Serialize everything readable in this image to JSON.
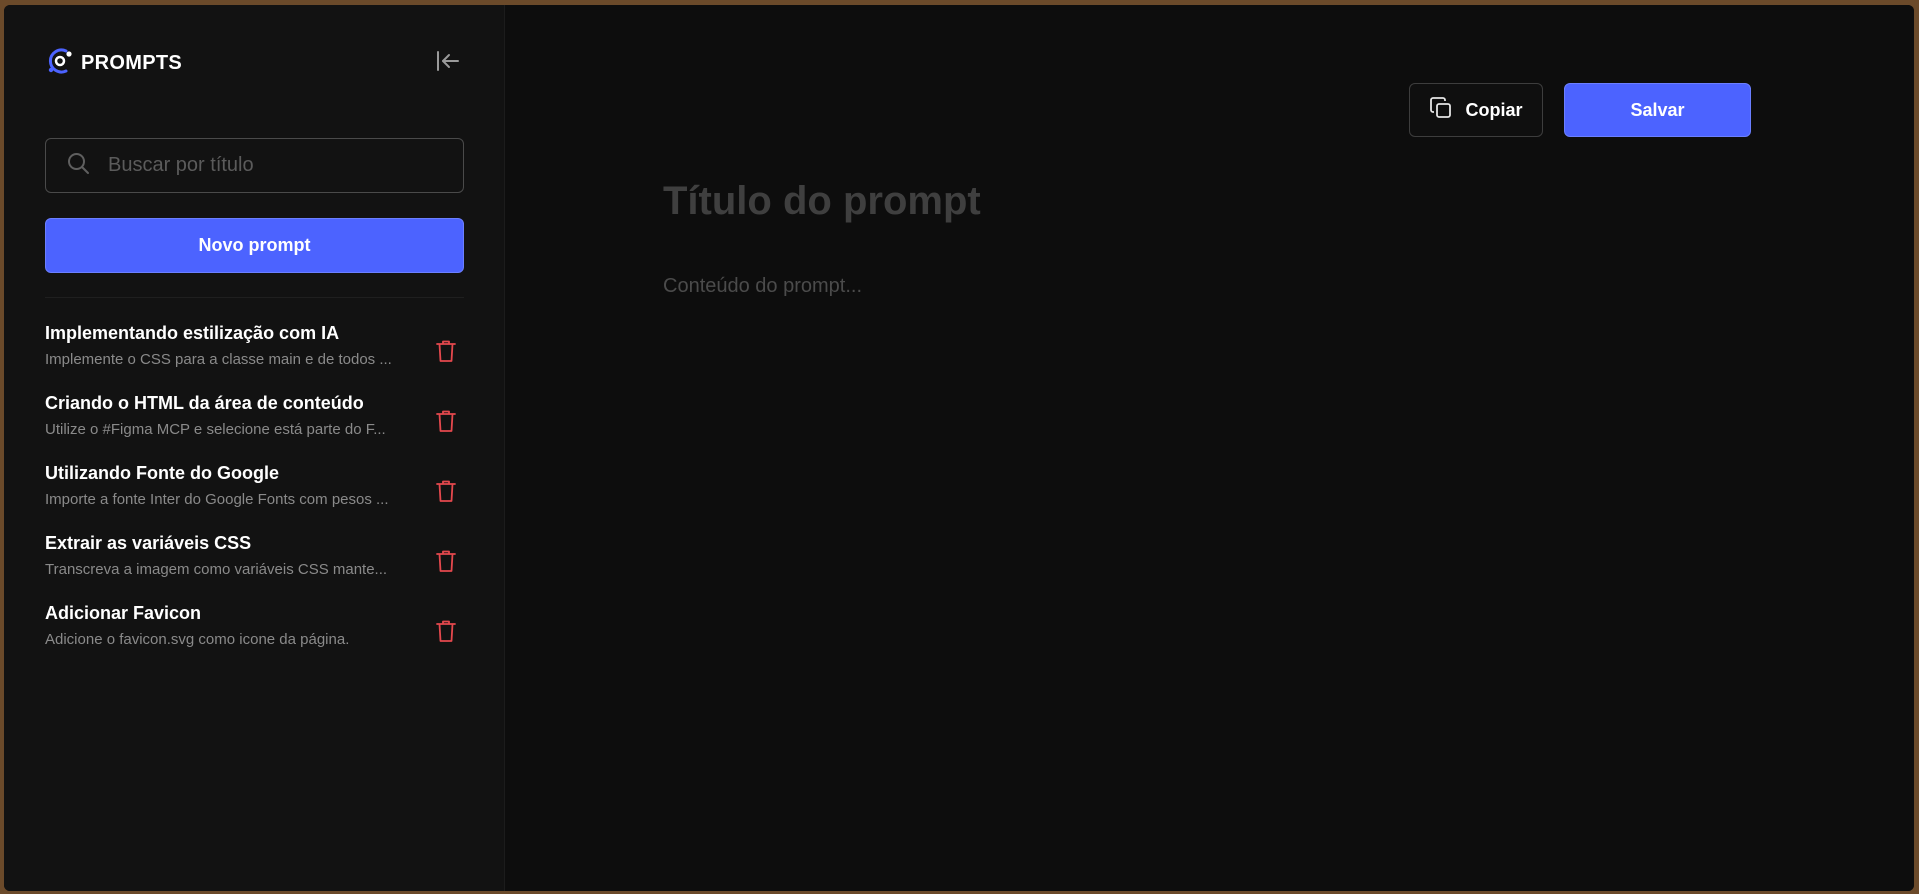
{
  "brand": {
    "name": "PROMPTS",
    "logo_icon": "logo-icon",
    "accent": "#4c63ff"
  },
  "sidebar": {
    "collapse_icon": "collapse-sidebar-icon",
    "search": {
      "placeholder": "Buscar por título",
      "value": ""
    },
    "new_button_label": "Novo prompt",
    "items": [
      {
        "title": "Implementando estilização com IA",
        "description": "Implemente o CSS para a classe main e de todos ..."
      },
      {
        "title": "Criando o HTML da área de conteúdo",
        "description": "Utilize o #Figma MCP e selecione está parte do F..."
      },
      {
        "title": "Utilizando Fonte do Google",
        "description": "Importe a fonte Inter do Google Fonts com pesos ..."
      },
      {
        "title": "Extrair as variáveis CSS",
        "description": "Transcreva a imagem como variáveis CSS mante..."
      },
      {
        "title": "Adicionar Favicon",
        "description": "Adicione o favicon.svg como icone da página."
      }
    ],
    "delete_icon": "trash-icon",
    "delete_color": "#e5484d"
  },
  "editor": {
    "copy_label": "Copiar",
    "save_label": "Salvar",
    "title_placeholder": "Título do prompt",
    "title_value": "",
    "content_placeholder": "Conteúdo do prompt...",
    "content_value": ""
  }
}
